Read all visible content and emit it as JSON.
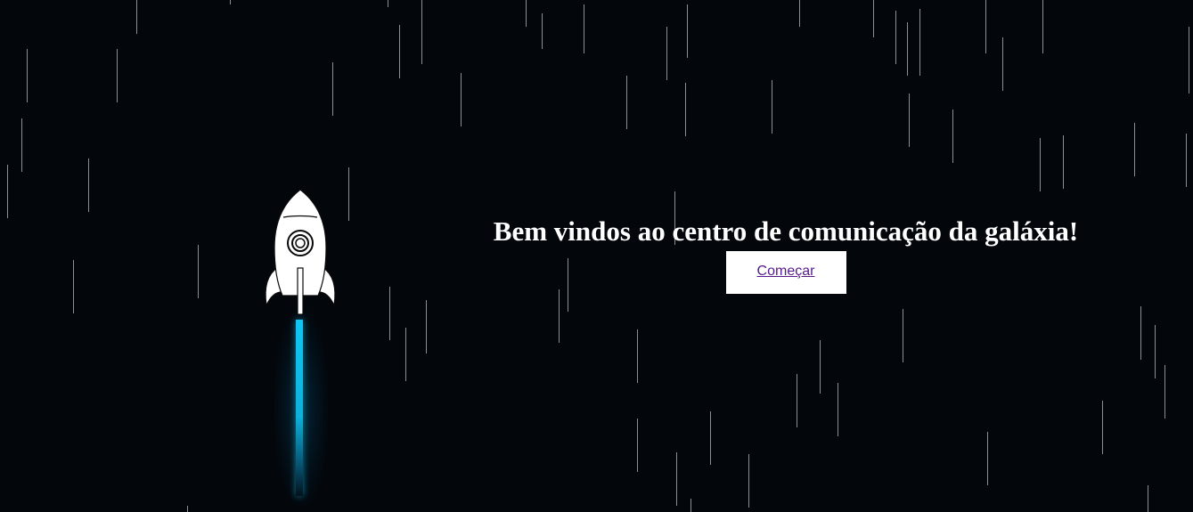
{
  "hero": {
    "title": "Bem vindos ao centro de comunicação da galáxia!",
    "start_label": "Começar"
  },
  "colors": {
    "background": "#03070c",
    "flame": "#10c6f3",
    "text": "#ffffff",
    "link_visited": "#551a8b"
  },
  "icons": {
    "rocket": "rocket-icon"
  }
}
